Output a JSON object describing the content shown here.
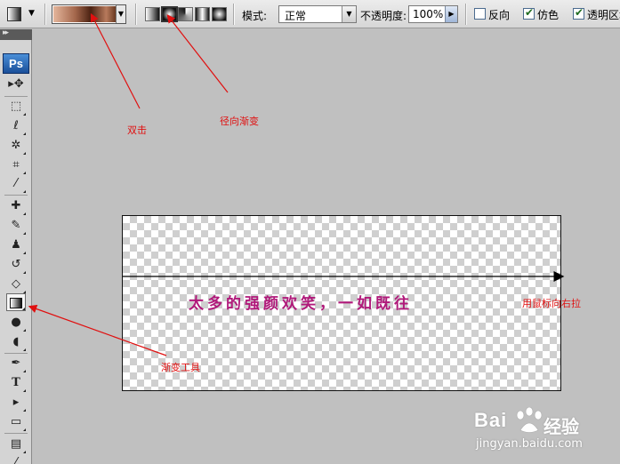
{
  "options_bar": {
    "tool_preset_icon": "gradient-tool-preset-icon",
    "gradient_picker_icon": "gradient-swatch",
    "gradient_types": [
      {
        "name": "linear",
        "icon": "linear-gradient-icon"
      },
      {
        "name": "radial",
        "icon": "radial-gradient-icon",
        "selected": true
      },
      {
        "name": "angle",
        "icon": "angle-gradient-icon"
      },
      {
        "name": "reflected",
        "icon": "reflected-gradient-icon"
      },
      {
        "name": "diamond",
        "icon": "diamond-gradient-icon"
      }
    ],
    "mode_label": "模式:",
    "mode_value": "正常",
    "opacity_label": "不透明度:",
    "opacity_value": "100%",
    "checkboxes": [
      {
        "label": "反向",
        "checked": false
      },
      {
        "label": "仿色",
        "checked": true
      },
      {
        "label": "透明区域",
        "checked": true
      }
    ]
  },
  "toolbox": {
    "logo": "Ps",
    "tools": [
      {
        "name": "move-tool",
        "glyph": "▸✥"
      },
      {
        "name": "marquee-tool",
        "glyph": "⬚"
      },
      {
        "name": "lasso-tool",
        "glyph": "ꝏ"
      },
      {
        "name": "magic-wand-tool",
        "glyph": "✲"
      },
      {
        "name": "crop-tool",
        "glyph": "⌗"
      },
      {
        "name": "eyedropper-tool",
        "glyph": "⁄"
      },
      {
        "name": "healing-brush-tool",
        "glyph": "✚"
      },
      {
        "name": "brush-tool",
        "glyph": "✎"
      },
      {
        "name": "clone-stamp-tool",
        "glyph": "♟"
      },
      {
        "name": "history-brush-tool",
        "glyph": "↺"
      },
      {
        "name": "eraser-tool",
        "glyph": "◇"
      },
      {
        "name": "gradient-tool",
        "glyph": "",
        "active": true
      },
      {
        "name": "blur-tool",
        "glyph": "●"
      },
      {
        "name": "dodge-tool",
        "glyph": "●"
      },
      {
        "name": "pen-tool",
        "glyph": "✒"
      },
      {
        "name": "type-tool",
        "glyph": "T"
      },
      {
        "name": "path-selection-tool",
        "glyph": "▸"
      },
      {
        "name": "shape-tool",
        "glyph": "▭"
      },
      {
        "name": "notes-tool",
        "glyph": "▤"
      },
      {
        "name": "hand-tool",
        "glyph": "⁄"
      }
    ]
  },
  "canvas": {
    "text": "太多的强颜欢笑，一如既往"
  },
  "annotations": {
    "double_click": "双击",
    "radial_gradient": "径向渐变",
    "gradient_tool": "渐变工具",
    "drag_right": "用鼠标向右拉"
  },
  "colors": {
    "annotation": "#e01010",
    "canvas_text": "#b0197a"
  },
  "watermark": {
    "logo_left": "Bai",
    "logo_right": "经验",
    "url": "jingyan.baidu.com"
  }
}
